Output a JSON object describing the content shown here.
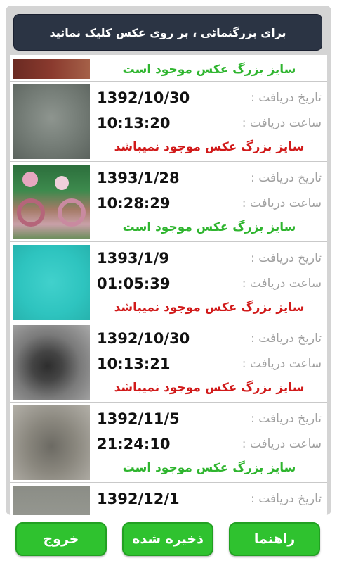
{
  "header": {
    "hint": "برای بزرگنمائی ، بر روی عکس کلیک نمائید"
  },
  "list": {
    "date_label": "تاریخ دریافت :",
    "time_label": "ساعت دریافت :",
    "status_available": "سایز بزرگ عکس موجود است",
    "status_unavailable": "سایز بزرگ عکس موجود نمیباشد",
    "partial_top": {
      "status": "سایز بزرگ عکس موجود است"
    },
    "items": [
      {
        "date": "1392/10/30",
        "time": "10:13:20",
        "status": "سایز بزرگ عکس موجود نمیباشد",
        "available": false
      },
      {
        "date": "1393/1/28",
        "time": "10:28:29",
        "status": "سایز بزرگ عکس موجود است",
        "available": true
      },
      {
        "date": "1393/1/9",
        "time": "01:05:39",
        "status": "سایز بزرگ عکس موجود نمیباشد",
        "available": false
      },
      {
        "date": "1392/10/30",
        "time": "10:13:21",
        "status": "سایز بزرگ عکس موجود نمیباشد",
        "available": false
      },
      {
        "date": "1392/11/5",
        "time": "21:24:10",
        "status": "سایز بزرگ عکس موجود است",
        "available": true
      },
      {
        "date": "1392/12/1"
      }
    ]
  },
  "footer": {
    "help_label": "راهنما",
    "saved_label": "ذخیره شده",
    "exit_label": "خروج"
  },
  "colors": {
    "header_bg": "#2b3444",
    "button_green": "#2fc22f",
    "status_ok": "#2fb52f",
    "status_no": "#d11a1a"
  }
}
